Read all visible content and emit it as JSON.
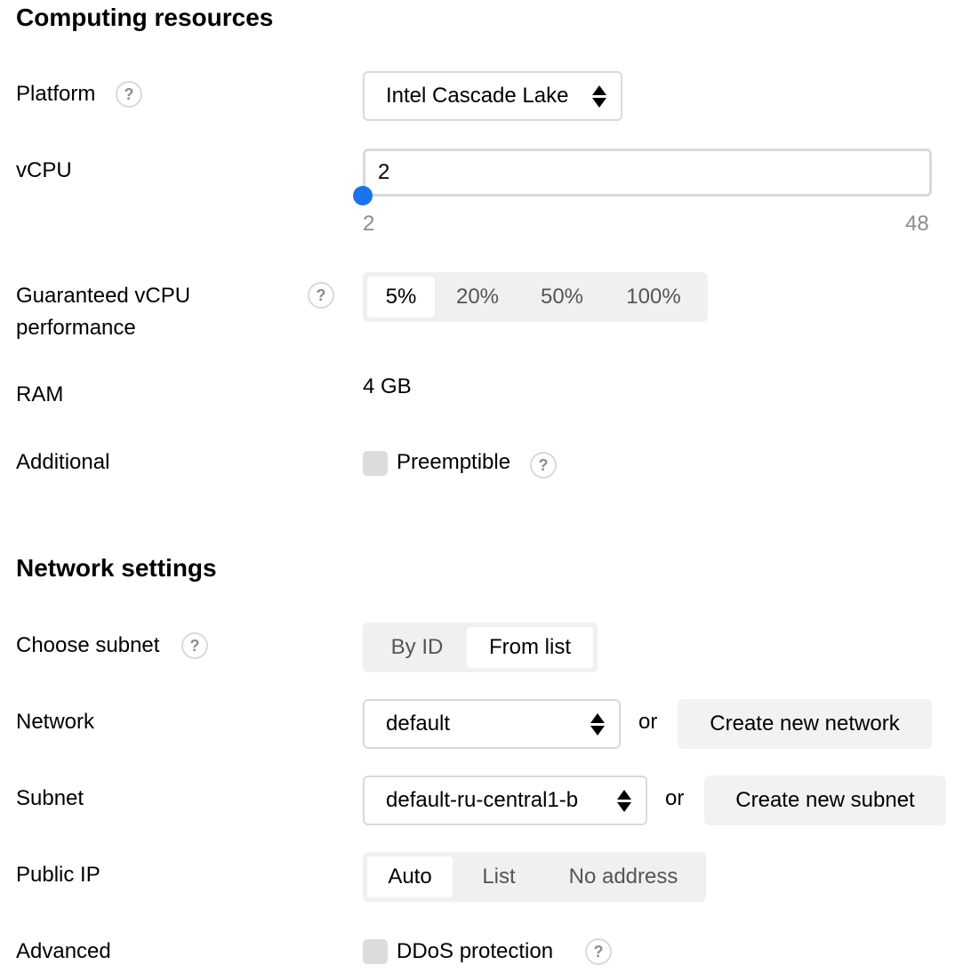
{
  "computing": {
    "title": "Computing resources",
    "platform": {
      "label": "Platform",
      "value": "Intel Cascade Lake"
    },
    "vcpu": {
      "label": "vCPU",
      "value": "2",
      "min": "2",
      "max": "48",
      "slider_fraction": 0
    },
    "guaranteed": {
      "label_line1": "Guaranteed vCPU",
      "label_line2": "performance",
      "options": [
        "5%",
        "20%",
        "50%",
        "100%"
      ],
      "selected": "5%"
    },
    "ram": {
      "label": "RAM",
      "value": "4 GB"
    },
    "additional": {
      "label": "Additional",
      "checkbox_label": "Preemptible",
      "checked": false
    }
  },
  "network": {
    "title": "Network settings",
    "subnet_choice": {
      "label": "Choose subnet",
      "options": [
        "By ID",
        "From list"
      ],
      "selected": "From list"
    },
    "network": {
      "label": "Network",
      "value": "default",
      "or": "or",
      "create_label": "Create new network"
    },
    "subnet": {
      "label": "Subnet",
      "value": "default-ru-central1-b",
      "or": "or",
      "create_label": "Create new subnet"
    },
    "public_ip": {
      "label": "Public IP",
      "options": [
        "Auto",
        "List",
        "No address"
      ],
      "selected": "Auto"
    },
    "advanced": {
      "label": "Advanced",
      "checkbox_label": "DDoS protection",
      "checked": false
    }
  },
  "help_glyph": "?",
  "colors": {
    "accent": "#1a73e8",
    "border": "#d9d9d9",
    "segment_bg": "#f0f0f0",
    "muted": "#8c8c8c"
  }
}
